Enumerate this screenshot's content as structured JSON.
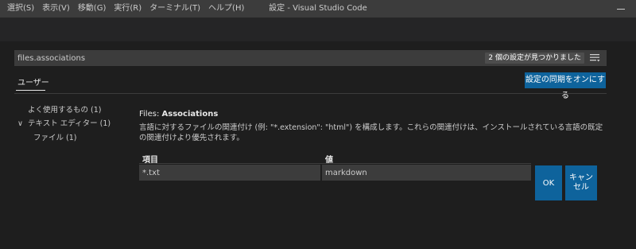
{
  "menu": [
    "選択(S)",
    "表示(V)",
    "移動(G)",
    "実行(R)",
    "ターミナル(T)",
    "ヘルプ(H)"
  ],
  "window": {
    "title": "設定 - Visual Studio Code"
  },
  "search": {
    "value": "files.associations",
    "result_count": "2 個の設定が見つかりました"
  },
  "tabs": {
    "user": "ユーザー"
  },
  "sync_button": "設定の同期をオンにする",
  "toc": {
    "common": "よく使用するもの (1)",
    "chevron": "∨",
    "text_editor": "テキスト エディター (1)",
    "files": "ファイル (1)"
  },
  "setting": {
    "category": "Files: ",
    "name": "Associations",
    "description": "言語に対するファイルの関連付け (例: \"*.extension\": \"html\") を構成します。これらの関連付けは、インストールされている言語の既定の関連付けより優先されます。"
  },
  "table": {
    "col_item": "項目",
    "col_value": "値",
    "row": {
      "item": "*.txt",
      "value": "markdown"
    }
  },
  "buttons": {
    "ok": "OK",
    "cancel": "キャンセル"
  },
  "colors": {
    "accent": "#0e639c",
    "background": "#1e1e1e",
    "titlebar": "#3c3c3c"
  }
}
